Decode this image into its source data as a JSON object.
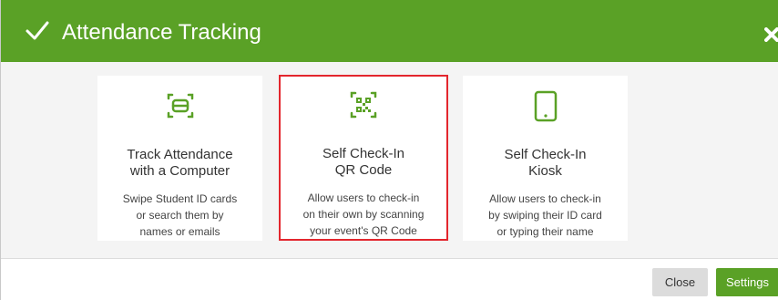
{
  "header": {
    "title": "Attendance Tracking"
  },
  "cards": [
    {
      "title_line1": "Track Attendance",
      "title_line2": "with a Computer",
      "desc_line1": "Swipe Student ID cards",
      "desc_line2": "or search them by",
      "desc_line3": "names or emails",
      "icon": "computer-scan-icon"
    },
    {
      "title_line1": "Self Check-In",
      "title_line2": "QR Code",
      "desc_line1": "Allow users to check-in",
      "desc_line2": "on their own by scanning",
      "desc_line3": "your event's QR Code",
      "icon": "qr-code-icon",
      "selected": true
    },
    {
      "title_line1": "Self Check-In",
      "title_line2": "Kiosk",
      "desc_line1": "Allow users to check-in",
      "desc_line2": "by swiping their ID card",
      "desc_line3": "or typing their name",
      "icon": "tablet-icon"
    }
  ],
  "footer": {
    "close_label": "Close",
    "settings_label": "Settings"
  },
  "colors": {
    "accent": "#5aa126",
    "selected_border": "#e3262d",
    "body_bg": "#f4f4f4"
  }
}
